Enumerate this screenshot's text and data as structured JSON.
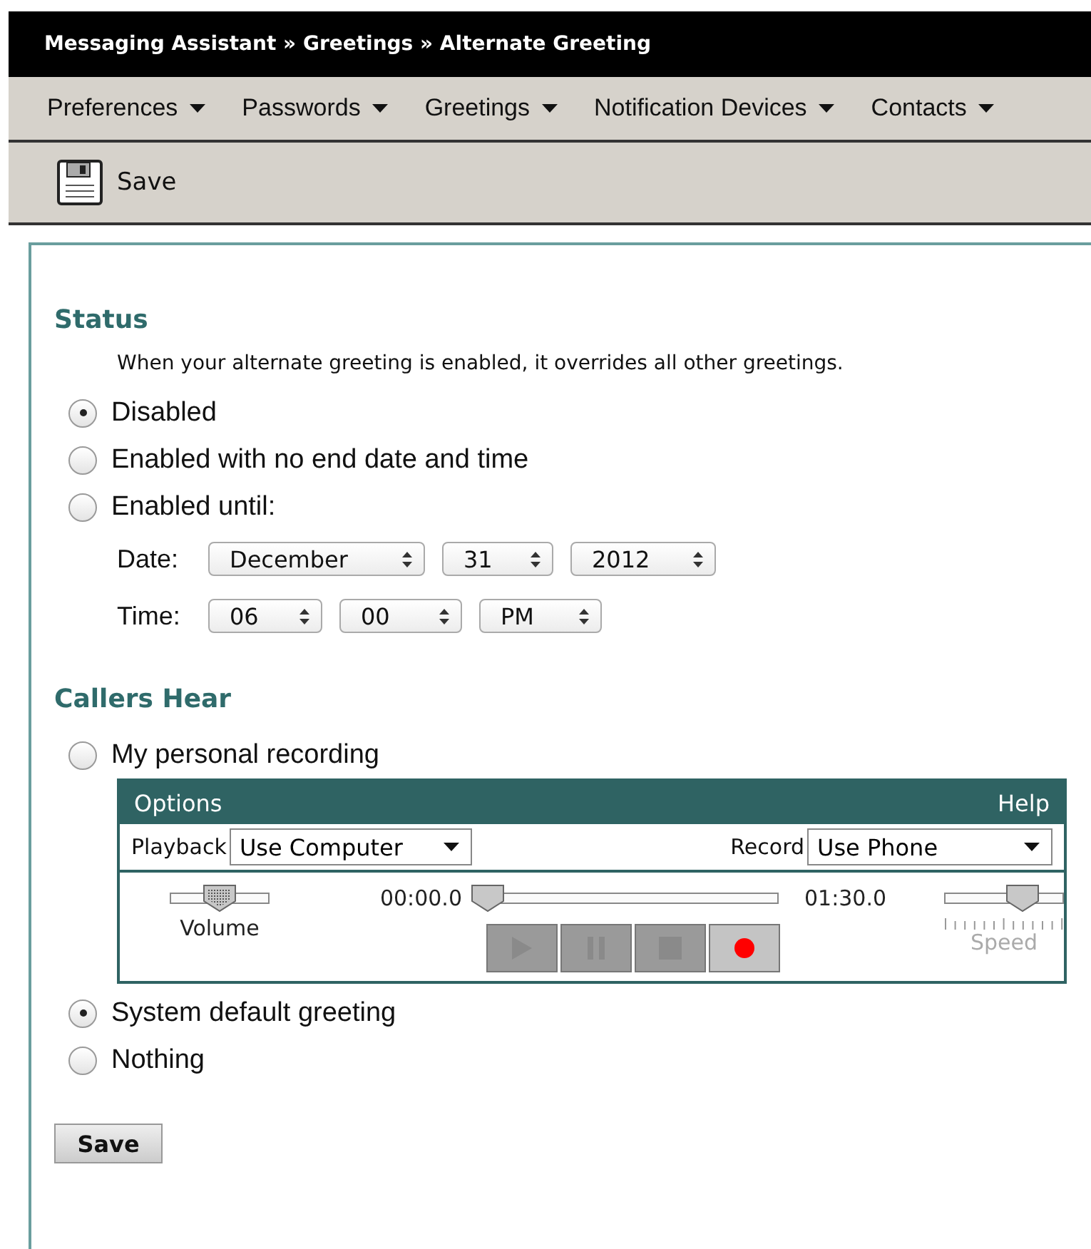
{
  "breadcrumb": "Messaging Assistant » Greetings » Alternate Greeting",
  "menu": [
    {
      "label": "Preferences"
    },
    {
      "label": "Passwords"
    },
    {
      "label": "Greetings"
    },
    {
      "label": "Notification Devices"
    },
    {
      "label": "Contacts"
    }
  ],
  "toolbar": {
    "save": "Save"
  },
  "status": {
    "heading": "Status",
    "description": "When your alternate greeting is enabled, it overrides all other greetings.",
    "options": [
      {
        "label": "Disabled",
        "selected": true
      },
      {
        "label": "Enabled with no end date and time",
        "selected": false
      },
      {
        "label": "Enabled until:",
        "selected": false
      }
    ],
    "date": {
      "label": "Date:",
      "selects": [
        "December",
        "31",
        "2012"
      ]
    },
    "time": {
      "label": "Time:",
      "selects": [
        "06",
        "00",
        "PM"
      ]
    }
  },
  "callers": {
    "heading": "Callers Hear",
    "options": [
      {
        "label": "My personal recording",
        "selected": false,
        "kind": "recording"
      },
      {
        "label": "System default greeting",
        "selected": true,
        "kind": "plain"
      },
      {
        "label": "Nothing",
        "selected": false,
        "kind": "plain"
      }
    ]
  },
  "recorder": {
    "menu_left": "Options",
    "menu_right": "Help",
    "playback_label": "Playback",
    "playback": "Use Computer",
    "record_label": "Record",
    "record": "Use Phone",
    "volume": {
      "label": "Volume",
      "level": 0.5
    },
    "position": {
      "start": "00:00.0",
      "end": "01:30.0",
      "level": 0
    },
    "speed": {
      "label": "Speed",
      "level": 0.65,
      "disabled": true
    },
    "buttons": [
      {
        "kind": "play",
        "disabled": true
      },
      {
        "kind": "pause",
        "disabled": true
      },
      {
        "kind": "stop",
        "disabled": true
      },
      {
        "kind": "record",
        "disabled": false
      }
    ]
  },
  "save_button": "Save"
}
